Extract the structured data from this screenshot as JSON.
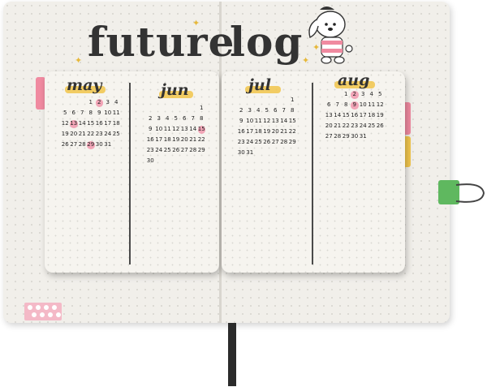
{
  "scene": {
    "title_word_1": "future",
    "title_word_2": "log"
  },
  "months": [
    {
      "name": "may",
      "leading_blanks": 3,
      "days": [
        "1",
        "2",
        "3",
        "4",
        "5",
        "6",
        "7",
        "8",
        "9",
        "10",
        "11",
        "12",
        "13",
        "14",
        "15",
        "16",
        "17",
        "18",
        "19",
        "20",
        "21",
        "22",
        "23",
        "24",
        "25",
        "26",
        "27",
        "28",
        "29",
        "30",
        "31"
      ],
      "highlighted": [
        "2",
        "13",
        "29"
      ]
    },
    {
      "name": "jun",
      "leading_blanks": 6,
      "days": [
        "1",
        "2",
        "3",
        "4",
        "5",
        "6",
        "7",
        "8",
        "9",
        "10",
        "11",
        "12",
        "13",
        "14",
        "15",
        "16",
        "17",
        "18",
        "19",
        "20",
        "21",
        "22",
        "23",
        "24",
        "25",
        "26",
        "27",
        "28",
        "29",
        "30"
      ],
      "highlighted": [
        "15"
      ]
    },
    {
      "name": "jul",
      "leading_blanks": 6,
      "days": [
        "1",
        "2",
        "3",
        "4",
        "5",
        "6",
        "7",
        "8",
        "9",
        "10",
        "11",
        "12",
        "13",
        "14",
        "15",
        "16",
        "17",
        "18",
        "19",
        "20",
        "21",
        "22",
        "23",
        "24",
        "25",
        "26",
        "27",
        "28",
        "29",
        "30",
        "31"
      ],
      "highlighted": []
    },
    {
      "name": "aug",
      "leading_blanks": 2,
      "days": [
        "1",
        "2",
        "3",
        "4",
        "5",
        "6",
        "7",
        "8",
        "9",
        "10",
        "11",
        "12",
        "13",
        "14",
        "15",
        "16",
        "17",
        "18",
        "19",
        "20",
        "21",
        "22",
        "23",
        "24",
        "25",
        "26",
        "27",
        "28",
        "29",
        "30",
        "31"
      ],
      "highlighted": [
        "2",
        "9"
      ]
    }
  ],
  "colors": {
    "highlight_yellow": "#f1c44a",
    "date_pink": "#f2a5b7",
    "tab_pink": "#f08aa0",
    "tab_yellow": "#f2c64e",
    "clip_green": "#5fb85f"
  }
}
